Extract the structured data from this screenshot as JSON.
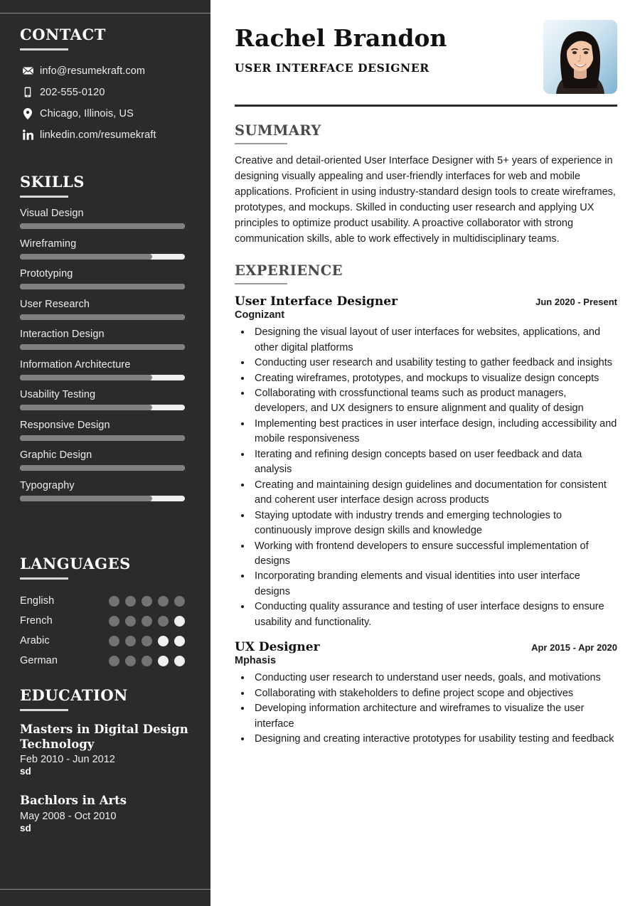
{
  "sidebar": {
    "contact": {
      "heading": "CONTACT",
      "items": [
        {
          "icon": "envelope-icon",
          "text": "info@resumekraft.com"
        },
        {
          "icon": "mobile-phone-icon",
          "text": "202-555-0120"
        },
        {
          "icon": "location-pin-icon",
          "text": "Chicago, Illinois, US"
        },
        {
          "icon": "linkedin-icon",
          "text": "linkedin.com/resumekraft"
        }
      ]
    },
    "skills": {
      "heading": "SKILLS",
      "items": [
        {
          "name": "Visual Design",
          "level": 100
        },
        {
          "name": "Wireframing",
          "level": 80
        },
        {
          "name": "Prototyping",
          "level": 100
        },
        {
          "name": "User Research",
          "level": 100
        },
        {
          "name": "Interaction Design",
          "level": 100
        },
        {
          "name": "Information Architecture",
          "level": 80
        },
        {
          "name": "Usability Testing",
          "level": 80
        },
        {
          "name": "Responsive Design",
          "level": 100
        },
        {
          "name": "Graphic Design",
          "level": 100
        },
        {
          "name": "Typography",
          "level": 80
        }
      ]
    },
    "languages": {
      "heading": "LANGUAGES",
      "max_dots": 5,
      "items": [
        {
          "name": "English",
          "rating": 5
        },
        {
          "name": "French",
          "rating": 4
        },
        {
          "name": "Arabic",
          "rating": 3
        },
        {
          "name": "German",
          "rating": 3
        }
      ]
    },
    "education": {
      "heading": "EDUCATION",
      "items": [
        {
          "degree": "Masters in Digital Design Technology",
          "dates": "Feb 2010 - Jun 2012",
          "school": "sd"
        },
        {
          "degree": "Bachlors in Arts",
          "dates": "May 2008 - Oct 2010",
          "school": "sd"
        }
      ]
    }
  },
  "main": {
    "name": "Rachel Brandon",
    "role": "USER INTERFACE DESIGNER",
    "summary": {
      "heading": "SUMMARY",
      "text": "Creative and detail-oriented User Interface Designer with 5+ years of experience in designing visually appealing and user-friendly interfaces for web and mobile applications. Proficient in using industry-standard design tools to create wireframes, prototypes, and mockups. Skilled in conducting user research and applying UX principles to optimize product usability. A proactive collaborator with strong communication skills, able to work effectively in multidisciplinary teams."
    },
    "experience": {
      "heading": "EXPERIENCE",
      "jobs": [
        {
          "title": "User Interface Designer",
          "company": "Cognizant",
          "dates": "Jun 2020 - Present",
          "bullets": [
            "Designing the visual layout of user interfaces for websites, applications, and other digital platforms",
            "Conducting user research and usability testing to gather feedback and insights",
            "Creating wireframes, prototypes, and mockups to visualize design concepts",
            "Collaborating with crossfunctional teams such as product managers, developers, and UX designers to ensure alignment and quality of design",
            "Implementing best practices in user interface design, including accessibility and mobile responsiveness",
            "Iterating and refining design concepts based on user feedback and data analysis",
            "Creating and maintaining design guidelines and documentation for consistent and coherent user interface design across products",
            "Staying uptodate with industry trends and emerging technologies to continuously improve design skills and knowledge",
            "Working with frontend developers to ensure successful implementation of designs",
            "Incorporating branding elements and visual identities into user interface designs",
            "Conducting quality assurance and testing of user interface designs to ensure usability and functionality."
          ]
        },
        {
          "title": "UX Designer",
          "company": "Mphasis",
          "dates": "Apr 2015 - Apr 2020",
          "bullets": [
            "Conducting user research to understand user needs, goals, and motivations",
            "Collaborating with stakeholders to define project scope and objectives",
            "Developing information architecture and wireframes to visualize the user interface",
            "Designing and creating interactive prototypes for usability testing and feedback"
          ]
        }
      ]
    }
  },
  "colors": {
    "sidebar_bg": "#2b2b2b",
    "page_bg": "#ffffff",
    "heading_gray": "#4a4a4a",
    "bar_fill": "#808080",
    "bar_track": "#f0f0f0",
    "dot_on": "#737373",
    "dot_off": "#f0f0f0"
  }
}
